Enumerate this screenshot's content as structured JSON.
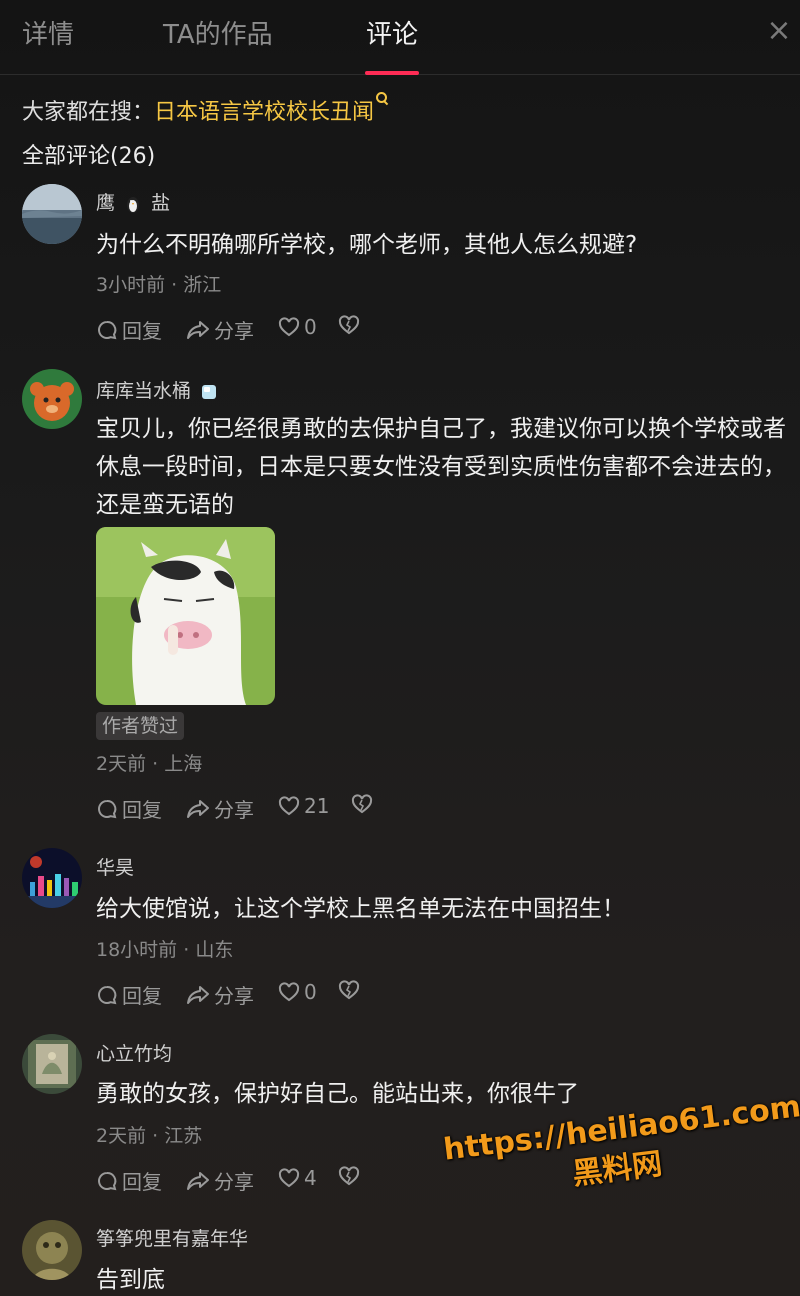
{
  "tabs": [
    {
      "label": "详情",
      "active": false
    },
    {
      "label": "TA的作品",
      "active": false
    },
    {
      "label": "评论",
      "active": true
    }
  ],
  "close_label": "×",
  "search": {
    "prefix": "大家都在搜：",
    "query": "日本语言学校校长丑闻"
  },
  "comments_header": "全部评论(26)",
  "actions": {
    "reply": "回复",
    "share": "分享"
  },
  "comments": [
    {
      "user": "鹰",
      "user_suffix": "盐",
      "text": "为什么不明确哪所学校，哪个老师，其他人怎么规避?",
      "time": "3小时前",
      "location": "浙江",
      "likes": "0"
    },
    {
      "user": "库库当水桶",
      "text": "宝贝儿，你已经很勇敢的去保护自己了，我建议你可以换个学校或者休息一段时间，日本是只要女性没有受到实质性伤害都不会进去的，还是蛮无语的",
      "badge": "作者赞过",
      "time": "2天前",
      "location": "上海",
      "likes": "21"
    },
    {
      "user": "华昊",
      "text": "给大使馆说，让这个学校上黑名单无法在中国招生！",
      "time": "18小时前",
      "location": "山东",
      "likes": "0"
    },
    {
      "user": "心立竹均",
      "text": "勇敢的女孩，保护好自己。能站出来，你很牛了",
      "time": "2天前",
      "location": "江苏",
      "likes": "4"
    },
    {
      "user": "筝筝兜里有嘉年华",
      "text": "告到底"
    }
  ],
  "meta_separator": " · ",
  "watermark": {
    "line1": "https://heiliao61.com",
    "line2": "黑料网"
  },
  "colors": {
    "accent": "#fe2c55",
    "search_link": "#f6c744",
    "watermark": "#f29a1a"
  }
}
